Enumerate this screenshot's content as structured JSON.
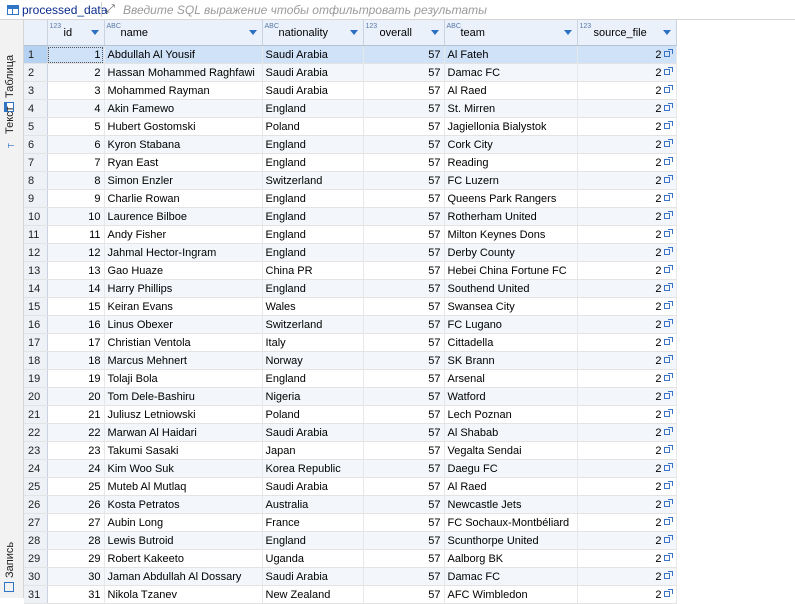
{
  "toolbar": {
    "table_name": "processed_data",
    "filter_placeholder": "Введите SQL выражение чтобы отфильтровать результаты"
  },
  "side_tabs": {
    "table": "Таблица",
    "text": "Текст",
    "record": "Запись"
  },
  "columns": [
    {
      "type": "123",
      "label": "id"
    },
    {
      "type": "ABC",
      "label": "name"
    },
    {
      "type": "ABC",
      "label": "nationality"
    },
    {
      "type": "123",
      "label": "overall"
    },
    {
      "type": "ABC",
      "label": "team"
    },
    {
      "type": "123",
      "label": "source_file"
    }
  ],
  "rows": [
    [
      "1",
      "1",
      "Abdullah Al Yousif",
      "Saudi Arabia",
      "57",
      "Al Fateh",
      "2"
    ],
    [
      "2",
      "2",
      "Hassan Mohammed Raghfawi",
      "Saudi Arabia",
      "57",
      "Damac FC",
      "2"
    ],
    [
      "3",
      "3",
      "Mohammed Rayman",
      "Saudi Arabia",
      "57",
      "Al Raed",
      "2"
    ],
    [
      "4",
      "4",
      "Akin Famewo",
      "England",
      "57",
      "St. Mirren",
      "2"
    ],
    [
      "5",
      "5",
      "Hubert Gostomski",
      "Poland",
      "57",
      "Jagiellonia Bialystok",
      "2"
    ],
    [
      "6",
      "6",
      "Kyron Stabana",
      "England",
      "57",
      "Cork City",
      "2"
    ],
    [
      "7",
      "7",
      "Ryan East",
      "England",
      "57",
      "Reading",
      "2"
    ],
    [
      "8",
      "8",
      "Simon Enzler",
      "Switzerland",
      "57",
      "FC Luzern",
      "2"
    ],
    [
      "9",
      "9",
      "Charlie Rowan",
      "England",
      "57",
      "Queens Park Rangers",
      "2"
    ],
    [
      "10",
      "10",
      "Laurence Bilboe",
      "England",
      "57",
      "Rotherham United",
      "2"
    ],
    [
      "11",
      "11",
      "Andy Fisher",
      "England",
      "57",
      "Milton Keynes Dons",
      "2"
    ],
    [
      "12",
      "12",
      "Jahmal Hector-Ingram",
      "England",
      "57",
      "Derby County",
      "2"
    ],
    [
      "13",
      "13",
      "Gao Huaze",
      "China PR",
      "57",
      "Hebei China Fortune FC",
      "2"
    ],
    [
      "14",
      "14",
      "Harry Phillips",
      "England",
      "57",
      "Southend United",
      "2"
    ],
    [
      "15",
      "15",
      "Keiran Evans",
      "Wales",
      "57",
      "Swansea City",
      "2"
    ],
    [
      "16",
      "16",
      "Linus Obexer",
      "Switzerland",
      "57",
      "FC Lugano",
      "2"
    ],
    [
      "17",
      "17",
      "Christian Ventola",
      "Italy",
      "57",
      "Cittadella",
      "2"
    ],
    [
      "18",
      "18",
      "Marcus Mehnert",
      "Norway",
      "57",
      "SK Brann",
      "2"
    ],
    [
      "19",
      "19",
      "Tolaji Bola",
      "England",
      "57",
      "Arsenal",
      "2"
    ],
    [
      "20",
      "20",
      "Tom Dele-Bashiru",
      "Nigeria",
      "57",
      "Watford",
      "2"
    ],
    [
      "21",
      "21",
      "Juliusz Letniowski",
      "Poland",
      "57",
      "Lech Poznan",
      "2"
    ],
    [
      "22",
      "22",
      "Marwan Al Haidari",
      "Saudi Arabia",
      "57",
      "Al Shabab",
      "2"
    ],
    [
      "23",
      "23",
      "Takumi Sasaki",
      "Japan",
      "57",
      "Vegalta Sendai",
      "2"
    ],
    [
      "24",
      "24",
      "Kim Woo Suk",
      "Korea Republic",
      "57",
      "Daegu FC",
      "2"
    ],
    [
      "25",
      "25",
      "Muteb Al Mutlaq",
      "Saudi Arabia",
      "57",
      "Al Raed",
      "2"
    ],
    [
      "26",
      "26",
      "Kosta Petratos",
      "Australia",
      "57",
      "Newcastle Jets",
      "2"
    ],
    [
      "27",
      "27",
      "Aubin Long",
      "France",
      "57",
      "FC Sochaux-Montbéliard",
      "2"
    ],
    [
      "28",
      "28",
      "Lewis Butroid",
      "England",
      "57",
      "Scunthorpe United",
      "2"
    ],
    [
      "29",
      "29",
      "Robert Kakeeto",
      "Uganda",
      "57",
      "Aalborg BK",
      "2"
    ],
    [
      "30",
      "30",
      "Jaman Abdullah Al Dossary",
      "Saudi Arabia",
      "57",
      "Damac FC",
      "2"
    ],
    [
      "31",
      "31",
      "Nikola Tzanev",
      "New Zealand",
      "57",
      "AFC Wimbledon",
      "2"
    ]
  ]
}
